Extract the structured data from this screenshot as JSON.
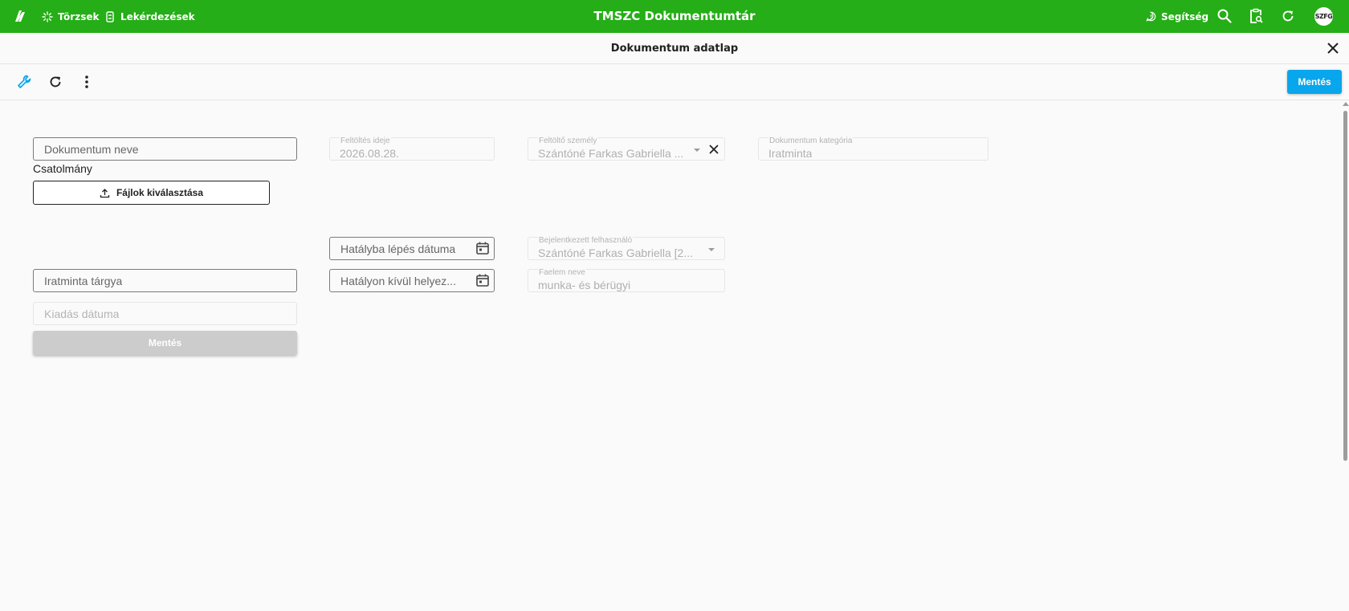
{
  "topbar": {
    "nav": [
      {
        "label": "Törzsek",
        "icon": "cog-spark-icon"
      },
      {
        "label": "Lekérdezések",
        "icon": "query-icon"
      }
    ],
    "title": "TMSZC Dokumentumtár",
    "help_label": "Segítség",
    "avatar_initials": "SZFG",
    "color": "#25ae17"
  },
  "dialog": {
    "title": "Dokumentum adatlap"
  },
  "toolbar": {
    "save_label": "Mentés",
    "accent": "#08a6ec"
  },
  "form": {
    "document_name": {
      "placeholder": "Dokumentum neve",
      "value": ""
    },
    "attachment_label": "Csatolmány",
    "file_button_label": "Fájlok kiválasztása",
    "upload_time": {
      "label": "Feltöltés ideje",
      "value": "2026.08.28."
    },
    "uploader": {
      "label": "Feltöltő személy",
      "value": "Szántóné Farkas Gabriella ..."
    },
    "category": {
      "label": "Dokumentum kategória",
      "value": "Iratminta"
    },
    "effective_date": {
      "placeholder": "Hatályba lépés dátuma",
      "value": ""
    },
    "logged_user": {
      "label": "Bejelentkezett felhasználó",
      "value": "Szántóné Farkas Gabriella [2..."
    },
    "subject": {
      "placeholder": "Iratminta tárgya",
      "value": ""
    },
    "revoke_date": {
      "placeholder": "Hatályon kívül helyez...",
      "value": ""
    },
    "faelem": {
      "label": "Faelem neve",
      "value": "munka- és bérügyi"
    },
    "issue_date": {
      "placeholder": "Kiadás dátuma",
      "value": ""
    },
    "save_label": "Mentés"
  }
}
